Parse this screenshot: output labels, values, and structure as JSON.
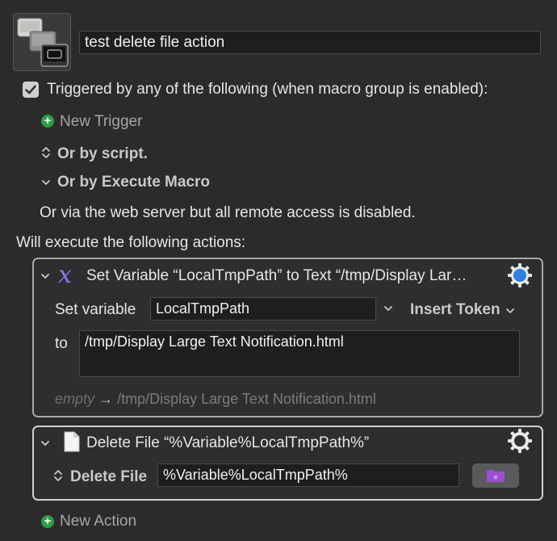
{
  "macro": {
    "name": "test delete file action",
    "triggered_label": "Triggered by any of the following (when macro group is enabled):",
    "triggered_checked": true,
    "new_trigger_label": "New Trigger",
    "or_by_script_label": "Or by script.",
    "or_by_execute_macro_label": "Or by Execute Macro",
    "web_server_text": "Or via the web server but all remote access is disabled.",
    "will_execute_label": "Will execute the following actions:",
    "new_action_label": "New Action"
  },
  "actions": [
    {
      "title": "Set Variable “LocalTmpPath” to Text “/tmp/Display Lar…",
      "icon": "x-variable-icon",
      "set_variable_label": "Set variable",
      "variable_name": "LocalTmpPath",
      "insert_token_label": "Insert Token",
      "to_label": "to",
      "text_value": "/tmp/Display Large Text Notification.html",
      "preview_empty": "empty",
      "preview_arrow": "→",
      "preview_value": "/tmp/Display Large Text Notification.html"
    },
    {
      "title": "Delete File “%Variable%LocalTmpPath%”",
      "icon": "document-icon",
      "mode_label": "Delete File",
      "path_value": "%Variable%LocalTmpPath%"
    }
  ],
  "colors": {
    "background": "#2b2b2d",
    "accent_blue": "#2f7fdc",
    "green_plus": "#2f9e44",
    "purple_x": "#8a7cf0",
    "folder_purple": "#9a4fd1"
  }
}
